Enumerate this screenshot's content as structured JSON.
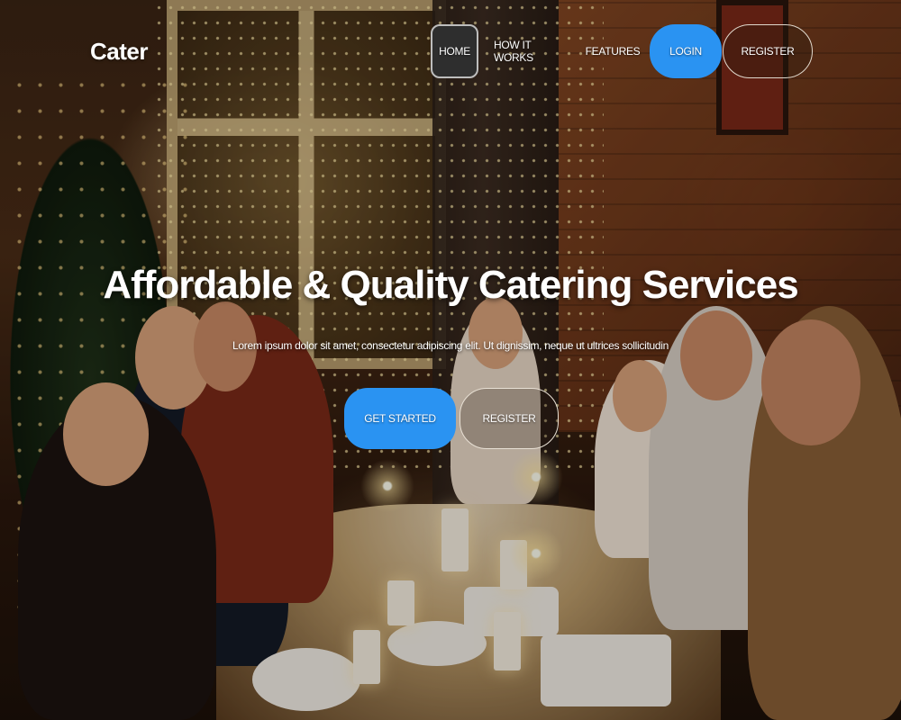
{
  "brand": {
    "name": "Cater"
  },
  "nav": {
    "home": "HOME",
    "how_it_works": "HOW IT WORKS",
    "features": "FEATURES",
    "login": "LOGIN",
    "register": "REGISTER"
  },
  "hero": {
    "title": "Affordable & Quality Catering Services",
    "subtitle": "Lorem ipsum dolor sit amet, consectetur adipiscing elit. Ut dignissim, neque ut ultrices sollicitudin",
    "cta_primary": "GET STARTED",
    "cta_secondary": "REGISTER",
    "background_image": "family-dinner-photo"
  },
  "colors": {
    "accent": "#2a93f2",
    "home_button_bg": "#2e2e2e",
    "text": "#ffffff"
  }
}
